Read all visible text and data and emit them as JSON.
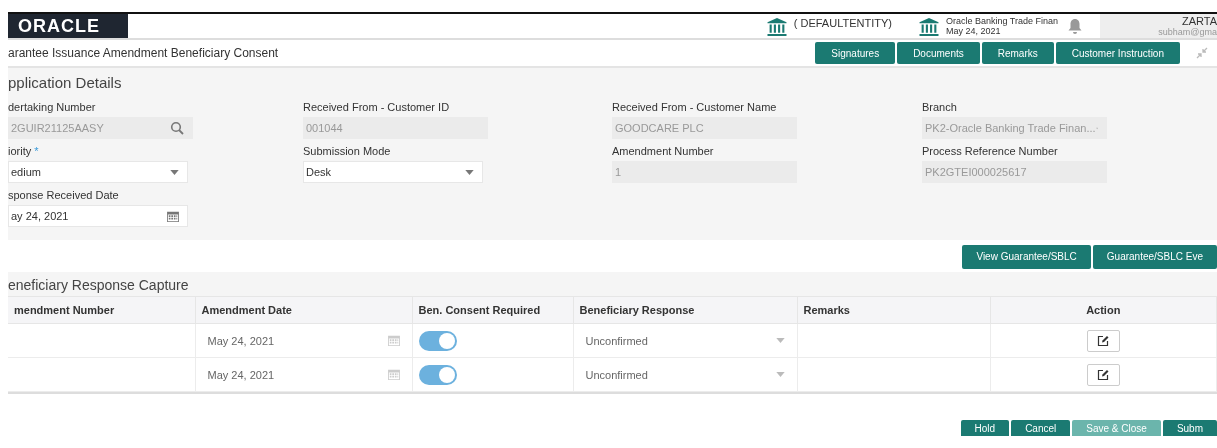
{
  "header": {
    "logo": "ORACLE",
    "entity": "( DEFAULTENTITY)",
    "app_name": "Oracle Banking Trade Finan",
    "app_date": "May 24, 2021",
    "user_name": "ZARTA",
    "user_email": "subham@gma"
  },
  "page_title": "arantee Issuance Amendment Beneficiary Consent",
  "title_buttons": [
    {
      "label": "Signatures"
    },
    {
      "label": "Documents"
    },
    {
      "label": "Remarks"
    },
    {
      "label": "Customer Instruction"
    }
  ],
  "application_details": {
    "heading": "pplication Details",
    "required_mark": "*",
    "fields": [
      {
        "label": "dertaking Number",
        "value": "2GUIR21125AASY",
        "kind": "search",
        "required": false,
        "disabled": true
      },
      {
        "label": "Received From - Customer ID",
        "value": "001044",
        "kind": "text",
        "required": false,
        "disabled": true
      },
      {
        "label": "Received From - Customer Name",
        "value": "GOODCARE PLC",
        "kind": "text",
        "required": false,
        "disabled": true
      },
      {
        "label": "Branch",
        "value": "PK2-Oracle Banking Trade Finan...",
        "kind": "select",
        "required": false,
        "disabled": true
      },
      {
        "label": "iority",
        "value": "edium",
        "kind": "select",
        "required": true,
        "disabled": false
      },
      {
        "label": "Submission Mode",
        "value": "Desk",
        "kind": "select",
        "required": false,
        "disabled": false
      },
      {
        "label": "Amendment Number",
        "value": "1",
        "kind": "text",
        "required": false,
        "disabled": true
      },
      {
        "label": "Process Reference Number",
        "value": "PK2GTEI000025617",
        "kind": "text",
        "required": false,
        "disabled": true
      },
      {
        "label": "sponse Received Date",
        "value": "ay 24, 2021",
        "kind": "date",
        "required": false,
        "disabled": false
      }
    ]
  },
  "section_buttons": [
    {
      "label": "View Guarantee/SBLC"
    },
    {
      "label": "Guarantee/SBLC Eve"
    }
  ],
  "response_capture": {
    "heading": "eneficiary Response Capture",
    "columns": [
      "mendment Number",
      "Amendment Date",
      "Ben. Consent Required",
      "Beneficiary Response",
      "Remarks",
      "Action"
    ],
    "rows": [
      {
        "amendment_date": "May 24, 2021",
        "consent_required": true,
        "response": "Unconfirmed"
      },
      {
        "amendment_date": "May 24, 2021",
        "consent_required": true,
        "response": "Unconfirmed"
      }
    ]
  },
  "footer_buttons": [
    {
      "label": "Hold",
      "disabled": false
    },
    {
      "label": "Cancel",
      "disabled": false
    },
    {
      "label": "Save & Close",
      "disabled": true
    },
    {
      "label": "Subm",
      "disabled": false
    }
  ]
}
